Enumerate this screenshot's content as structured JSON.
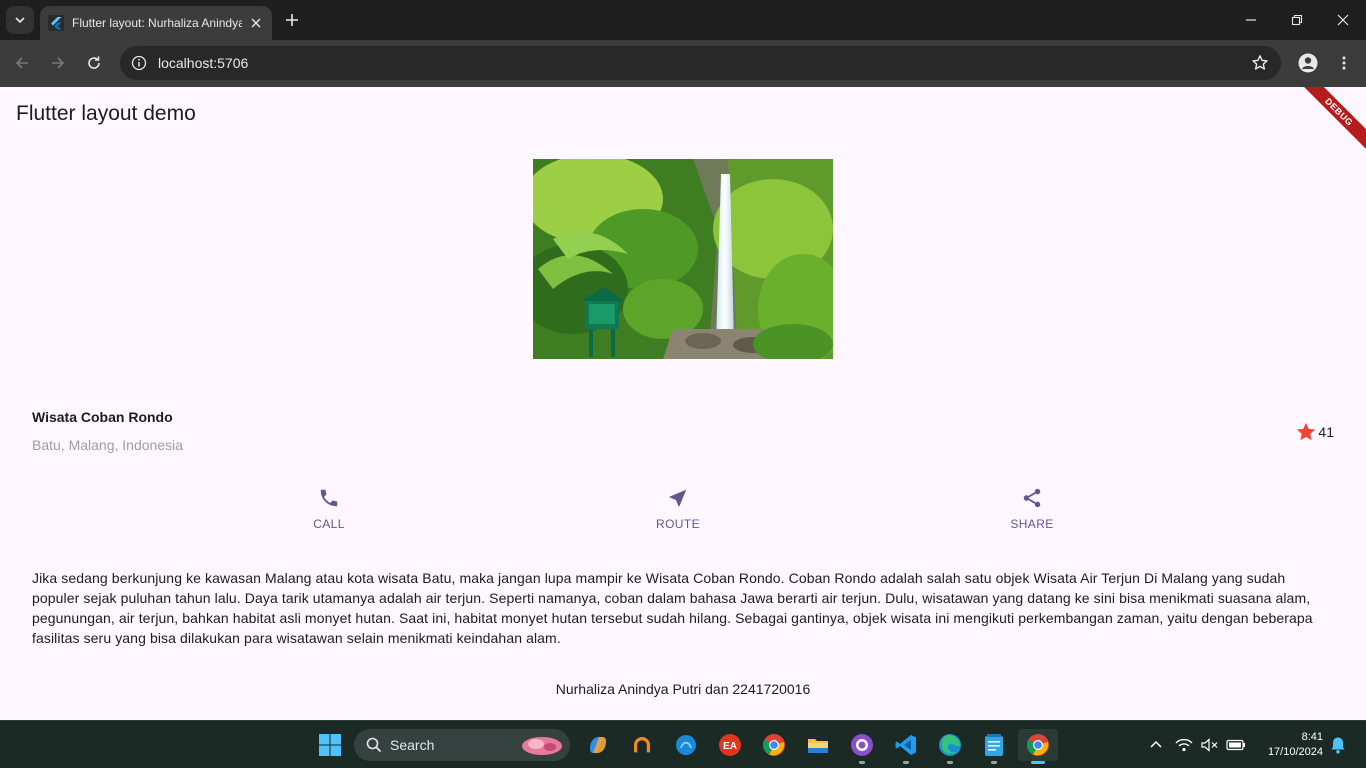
{
  "browser": {
    "tab_title": "Flutter layout: Nurhaliza Anindya",
    "url": "localhost:5706"
  },
  "app": {
    "title": "Flutter layout demo",
    "debug_banner": "DEBUG"
  },
  "place": {
    "name": "Wisata Coban Rondo",
    "location": "Batu, Malang, Indonesia",
    "rating_count": "41"
  },
  "actions": [
    {
      "label": "CALL",
      "icon": "phone-icon"
    },
    {
      "label": "ROUTE",
      "icon": "near-me-icon"
    },
    {
      "label": "SHARE",
      "icon": "share-icon"
    }
  ],
  "description": "Jika sedang berkunjung ke kawasan Malang atau kota wisata Batu, maka jangan lupa mampir ke Wisata Coban Rondo. Coban Rondo adalah salah satu objek Wisata Air Terjun Di Malang yang sudah populer sejak puluhan tahun lalu. Daya tarik utamanya adalah air terjun. Seperti namanya, coban dalam bahasa Jawa berarti air terjun. Dulu, wisatawan yang datang ke sini bisa menikmati suasana alam, pegunungan, air terjun, bahkan habitat asli monyet hutan. Saat ini, habitat monyet hutan tersebut sudah hilang. Sebagai gantinya, objek wisata ini mengikuti perkembangan zaman, yaitu dengan beberapa fasilitas seru yang bisa dilakukan para wisatawan selain menikmati keindahan alam.",
  "footer": "Nurhaliza Anindya Putri dan 2241720016",
  "taskbar": {
    "search_label": "Search",
    "time": "8:41",
    "date": "17/10/2024"
  },
  "colors": {
    "accent": "#65558f",
    "star": "#f44336",
    "page_bg": "#fef7ff"
  }
}
